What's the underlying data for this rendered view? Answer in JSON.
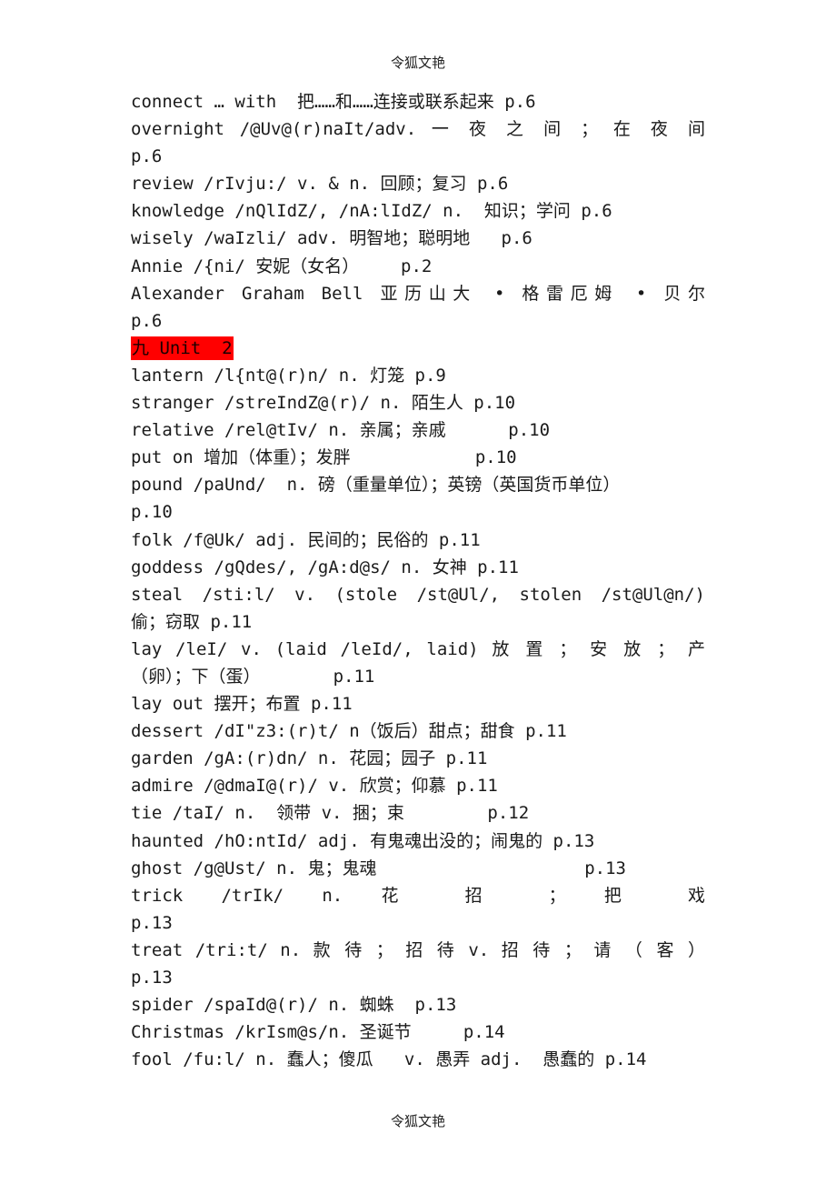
{
  "header": {
    "text": "令狐文艳"
  },
  "footer": {
    "text": "令狐文艳"
  },
  "lines": [
    {
      "text": "connect … with  把……和……连接或联系起来 p.6"
    },
    {
      "text": "overnight  /@Uv@(r)naIt/adv.  一 夜 之 间 ；  在 夜 间",
      "justify": true
    },
    {
      "text": "p.6"
    },
    {
      "text": "review /rIvju:/ v. & n. 回顾；复习 p.6"
    },
    {
      "text": "knowledge /nQlIdZ/, /nA:lIdZ/ n.  知识；学问 p.6"
    },
    {
      "text": "wisely /waIzli/ adv. 明智地；聪明地   p.6"
    },
    {
      "text": "Annie /{ni/ 安妮（女名）    p.2"
    },
    {
      "text": "Alexander Graham Bell 亚历山大 • 格雷厄姆 • 贝尔",
      "justify": true
    },
    {
      "text": "p.6"
    },
    {
      "text": "九 Unit  2",
      "heading": true
    },
    {
      "text": "lantern /l{nt@(r)n/ n. 灯笼 p.9"
    },
    {
      "text": "stranger /streIndZ@(r)/ n. 陌生人 p.10"
    },
    {
      "text": "relative /rel@tIv/ n. 亲属；亲戚      p.10"
    },
    {
      "text": "put on 增加（体重）；发胖            p.10"
    },
    {
      "text": "pound /paUnd/  n. 磅（重量单位）；英镑（英国货币单位）"
    },
    {
      "text": "p.10"
    },
    {
      "text": "folk /f@Uk/ adj. 民间的；民俗的 p.11"
    },
    {
      "text": "goddess /gQdes/, /gA:d@s/ n. 女神 p.11"
    },
    {
      "text": "steal  /sti:l/  v.  (stole  /st@Ul/,  stolen  /st@Ul@n/)",
      "justify": true
    },
    {
      "text": "偷；窃取 p.11"
    },
    {
      "text": "lay  /leI/    v.    (laid  /leId/,  laid) 放 置 ； 安 放 ； 产",
      "justify": true
    },
    {
      "text": "（卵）；下（蛋）       p.11"
    },
    {
      "text": "lay out 摆开；布置 p.11"
    },
    {
      "text": "dessert /dI\"z3:(r)t/ n（饭后）甜点；甜食 p.11"
    },
    {
      "text": "garden /gA:(r)dn/ n. 花园；园子 p.11"
    },
    {
      "text": "admire /@dmaI@(r)/ v. 欣赏；仰慕 p.11"
    },
    {
      "text": "tie /taI/ n.  领带 v. 捆；束        p.12"
    },
    {
      "text": "haunted /hO:ntId/ adj. 有鬼魂出没的；闹鬼的 p.13"
    },
    {
      "text": "ghost /g@Ust/ n. 鬼；鬼魂                    p.13"
    },
    {
      "text": "trick     /trIk/      n.      花     招     ；     把     戏",
      "justify": true
    },
    {
      "text": "p.13"
    },
    {
      "text": "treat  /tri:t/  n.  款 待 ； 招 待  v.  招 待 ； 请 （ 客 ）",
      "justify": true
    },
    {
      "text": "p.13"
    },
    {
      "text": "spider /spaId@(r)/ n. 蜘蛛  p.13"
    },
    {
      "text": "Christmas /krIsm@s/n. 圣诞节     p.14"
    },
    {
      "text": "fool /fu:l/ n. 蠢人；傻瓜   v. 愚弄 adj.  愚蠢的 p.14"
    }
  ],
  "colors": {
    "heading_highlight": "#ff0000"
  }
}
